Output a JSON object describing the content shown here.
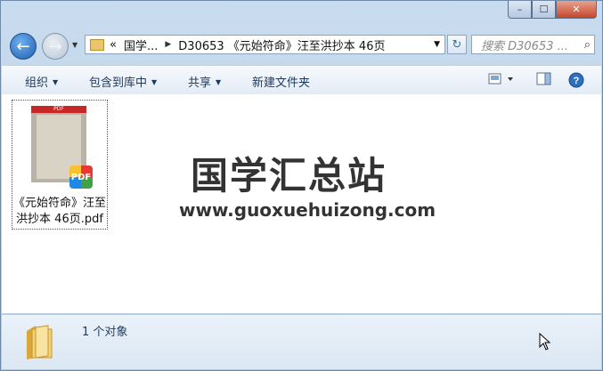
{
  "caption": {
    "minimize": "–",
    "maximize": "☐",
    "close": "✕"
  },
  "nav": {
    "back": "←",
    "forward": "→",
    "dropdown": "▼"
  },
  "address": {
    "chevrons": "«",
    "segment1": "国学...",
    "separator": "▶",
    "segment2": "D30653 《元始符命》汪至洪抄本 46页",
    "dropdown": "▼"
  },
  "refresh": "↻",
  "search": {
    "placeholder": "搜索 D30653 ...",
    "icon": "⌕"
  },
  "toolbar": {
    "organize": "组织",
    "include_library": "包含到库中",
    "share": "共享",
    "new_folder": "新建文件夹"
  },
  "file": {
    "name_line1": "《元始符命》汪至",
    "name_line2": "洪抄本 46页.pdf",
    "badge": "PDF",
    "thumb_band": "PDF"
  },
  "watermark": {
    "title": "国学汇总站",
    "url": "www.guoxuehuizong.com"
  },
  "status": {
    "count": "1 个对象"
  },
  "colors": {
    "accent": "#1e395b",
    "close": "#c6452a"
  }
}
